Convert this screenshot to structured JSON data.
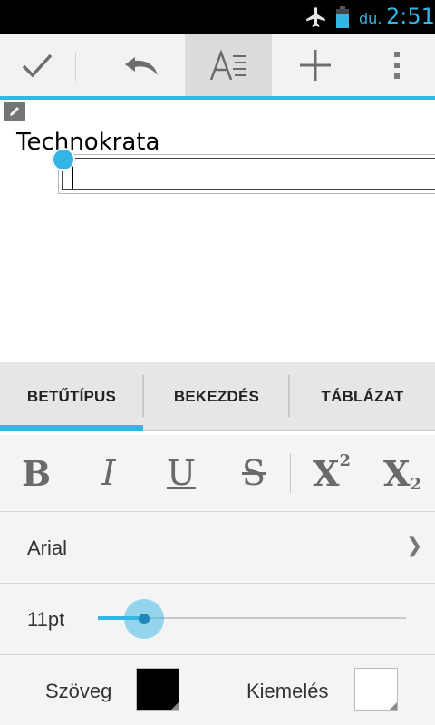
{
  "status_bar": {
    "ampm": "du.",
    "time": "2:51",
    "icons": [
      "airplane-icon",
      "battery-icon"
    ]
  },
  "action_bar": {
    "buttons": [
      "checkmark-icon",
      "undo-icon",
      "text-format-icon",
      "add-icon",
      "overflow-menu-icon"
    ]
  },
  "document": {
    "text": "Technokrata"
  },
  "tabs": [
    {
      "label": "BETŰTÍPUS",
      "selected": true
    },
    {
      "label": "BEKEZDÉS",
      "selected": false
    },
    {
      "label": "TÁBLÁZAT",
      "selected": false
    }
  ],
  "format_buttons": {
    "bold": "B",
    "italic": "I",
    "underline": "U",
    "strikethrough": "S",
    "superscript": "X",
    "superscript_mark": "2",
    "subscript": "X",
    "subscript_mark": "2"
  },
  "font_row": {
    "font_name": "Arial",
    "chevron": "❯"
  },
  "size_row": {
    "size_label": "11pt",
    "slider_fraction": 0.15
  },
  "color_row": {
    "text_color_label": "Szöveg",
    "text_color": "#000000",
    "highlight_label": "Kiemelés",
    "highlight_color": "#ffffff"
  },
  "colors": {
    "accent": "#33b5e5",
    "status_bar_bg": "#000000"
  }
}
